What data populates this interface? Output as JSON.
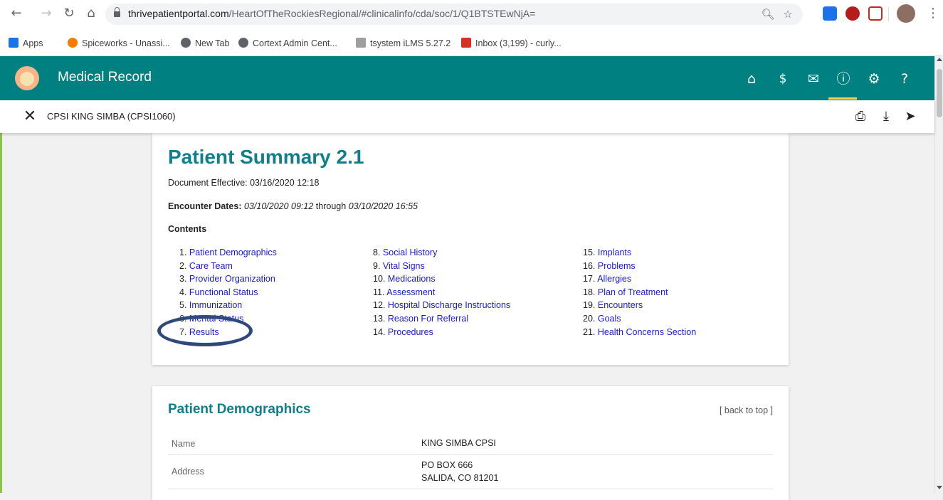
{
  "browser": {
    "url_domain": "thrivepatientportal.com",
    "url_path": "/HeartOfTheRockiesRegional/#clinicalinfo/cda/soc/1/Q1BTSTEwNjA=",
    "bookmarks": [
      {
        "label": "Apps",
        "icon": "apps-grid-icon",
        "color": "#1a73e8"
      },
      {
        "label": "Spiceworks - Unassi...",
        "icon": "spiceworks-icon",
        "color": "#f57c00"
      },
      {
        "label": "New Tab",
        "icon": "globe-icon",
        "color": "#5f6368"
      },
      {
        "label": "Cortext Admin Cent...",
        "icon": "globe-icon",
        "color": "#5f6368"
      },
      {
        "label": "tsystem iLMS 5.27.2",
        "icon": "ilms-icon",
        "color": "#9e9e9e"
      },
      {
        "label": "Inbox (3,199) - curly...",
        "icon": "gmail-icon",
        "color": "#d93025"
      }
    ]
  },
  "app": {
    "title": "Medical Record",
    "accent": "#008080",
    "nav_icons": [
      "home-icon",
      "dollar-icon",
      "mail-icon",
      "info-icon",
      "settings-icon",
      "help-icon"
    ],
    "patient": "CPSI KING SIMBA (CPSI1060)"
  },
  "summary": {
    "title": "Patient Summary 2.1",
    "effective": "Document Effective: 03/16/2020 12:18",
    "encounter_label": "Encounter Dates:",
    "encounter_start": "03/10/2020 09:12",
    "through": "through",
    "encounter_end": "03/10/2020 16:55",
    "contents_label": "Contents",
    "toc_col1": [
      {
        "num": "1.",
        "label": "Patient Demographics"
      },
      {
        "num": "2.",
        "label": "Care Team"
      },
      {
        "num": "3.",
        "label": "Provider Organization"
      },
      {
        "num": "4.",
        "label": "Functional Status"
      },
      {
        "num": "5.",
        "label": "Immunization"
      },
      {
        "num": "6.",
        "label": "Mental Status"
      },
      {
        "num": "7.",
        "label": "Results"
      }
    ],
    "toc_col2": [
      {
        "num": "8.",
        "label": "Social History"
      },
      {
        "num": "9.",
        "label": "Vital Signs"
      },
      {
        "num": "10.",
        "label": "Medications"
      },
      {
        "num": "11.",
        "label": "Assessment"
      },
      {
        "num": "12.",
        "label": "Hospital Discharge Instructions"
      },
      {
        "num": "13.",
        "label": "Reason For Referral"
      },
      {
        "num": "14.",
        "label": "Procedures"
      }
    ],
    "toc_col3": [
      {
        "num": "15.",
        "label": "Implants"
      },
      {
        "num": "16.",
        "label": "Problems"
      },
      {
        "num": "17.",
        "label": "Allergies"
      },
      {
        "num": "18.",
        "label": "Plan of Treatment"
      },
      {
        "num": "19.",
        "label": "Encounters"
      },
      {
        "num": "20.",
        "label": "Goals"
      },
      {
        "num": "21.",
        "label": "Health Concerns Section"
      }
    ]
  },
  "demographics": {
    "title": "Patient Demographics",
    "back_to_top": "[ back to top ]",
    "rows": [
      {
        "label": "Name",
        "value_line1": "KING SIMBA CPSI",
        "value_line2": ""
      },
      {
        "label": "Address",
        "value_line1": "PO BOX 666",
        "value_line2": "SALIDA, CO 81201"
      }
    ]
  }
}
